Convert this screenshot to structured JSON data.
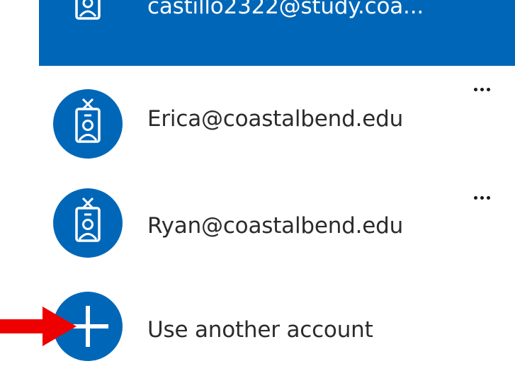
{
  "accent_color": "#0067b8",
  "arrow_color": "#ee0000",
  "accounts": [
    {
      "label": "castillo2322@study.coa...",
      "selected": true,
      "icon": "badge-person-icon"
    },
    {
      "label": "Erica@coastalbend.edu",
      "selected": false,
      "icon": "badge-person-icon",
      "more_icon": "more-options-icon"
    },
    {
      "label": "Ryan@coastalbend.edu",
      "selected": false,
      "icon": "badge-person-icon",
      "more_icon": "more-options-icon"
    }
  ],
  "add_account": {
    "label": "Use another account",
    "icon": "plus-icon"
  },
  "annotation": {
    "icon": "red-arrow-icon"
  }
}
